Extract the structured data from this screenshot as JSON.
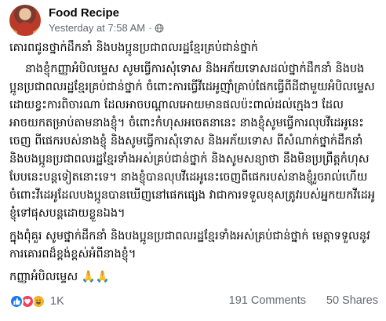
{
  "post": {
    "author": "Food Recipe",
    "timestamp": "Yesterday at 7:58 AM",
    "separator": "·",
    "title": "គោរពជូនថ្នាក់ដឹកនាំ និងបងប្អូនប្រជាពលរដ្ឋខ្មែរគ្រប់ជាន់ថ្នាក់",
    "paragraph1": "នាងខ្ញុំកញ្ញាអំបិលម្ទេស សូមធ្វើការសុំទោស និងអភ័យទោសដល់ថ្នាក់ដឹកនាំ និងបងប្អូនប្រជាពលរដ្ឋខ្មែរគ្រប់ជាន់ថ្នាក់ ចំពោះការធ្វើវីដេអូញ៉ាំគ្រាប់ផែកធ្វើពីដីជាមួយអំបិលម្ទេស ដោយខ្វះការពិចារណា ដែលអាចបណ្តាលអោយមានផលប៉ះពាល់ដល់ក្មេងៗ ដែលអាចយកតម្រាប់តាមនាងខ្ញុំ។ ចំពោះកំហុសអចេតនានេះ នាងខ្ញុំសូមធ្វើការលុបវីដេអូនេះចេញ ពីផេករបស់នាងខ្ញុំ និងសូមធ្វើការសុំទោស និងអភ័យទោស ពីសំណាក់ថ្នាក់ដឹកនាំ និងបងប្អូនប្រជាពលរដ្ឋខ្មែរទាំងអស់គ្រប់ជាន់ថ្នាក់ និងសូមសន្យាថា នឹងមិនប្រព្រឹត្តកំហុសបែបនេះបន្តទៀតនោះទេ។ នាងខ្ញុំបានលុបវីដេអូនេះចេញពីផេករបស់នាងខ្ញុំរួចរាល់ហើយ ចំពោះវីដេអូដែលបងប្អូនបានឃើញនៅផេកផ្សេង វាជាការទទួលខុសត្រូវរបស់អ្នកយកវីដេអូខ្ញុំទៅផុសបន្តដោយខ្លួនឯង។",
    "paragraph2": "ក្នុងពុំគួរ សូមថ្នាក់ដឹកនាំ និងបងប្អូនប្រជាពលរដ្ឋខ្មែរទាំងអស់គ្រប់ជាន់ថ្នាក់ មេត្តាទទួលនូវការគោរពដ៏ខ្ពង់ខ្ពស់អំពីនាងខ្ញុំ។",
    "signature": "កញ្ញាអំបិលម្ទេស 🙏🙏"
  },
  "stats": {
    "reactions_count": "1K",
    "comments": "191 Comments",
    "shares": "50 Shares",
    "reaction_icons": [
      "like-icon",
      "love-icon",
      "haha-icon"
    ]
  },
  "colors": {
    "text": "#050505",
    "meta": "#65676b",
    "like": "#1877f2",
    "love": "#f33e58",
    "haha": "#f7b125"
  }
}
